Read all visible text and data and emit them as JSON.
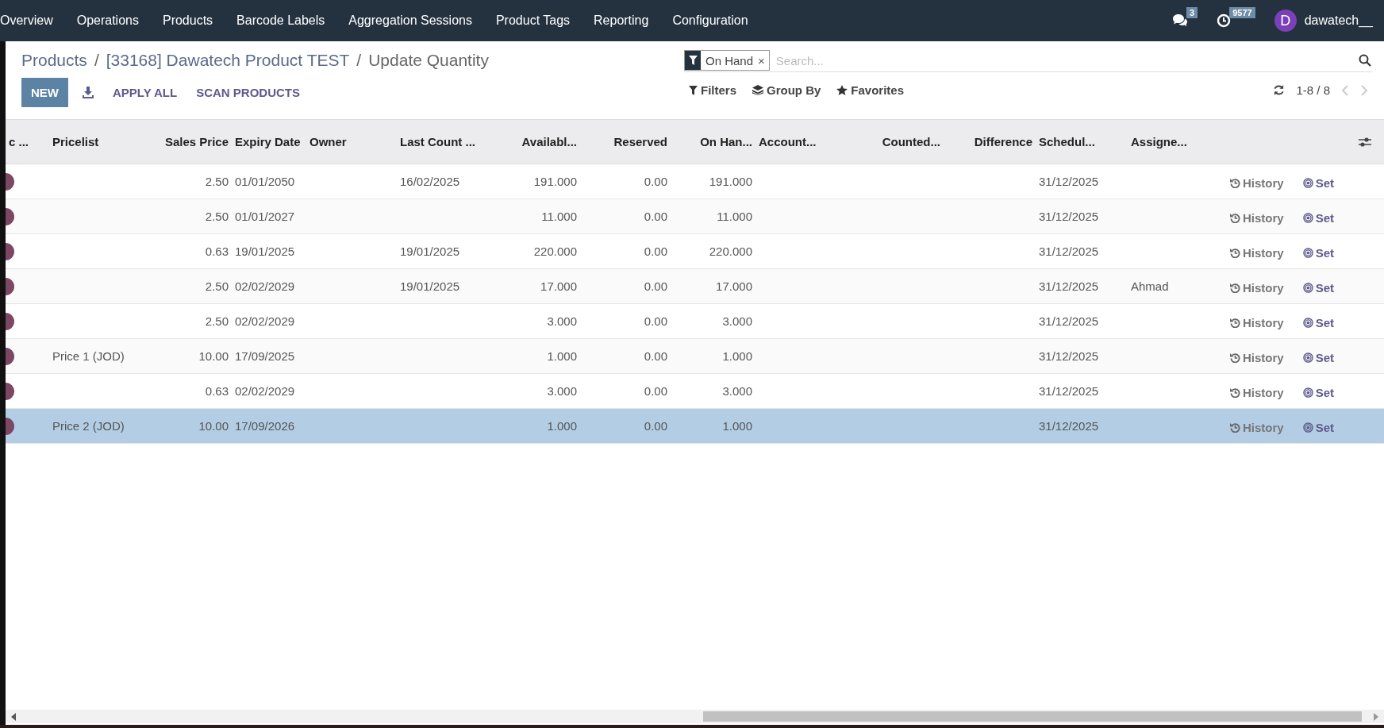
{
  "navbar": {
    "menu": [
      "Overview",
      "Operations",
      "Products",
      "Barcode Labels",
      "Aggregation Sessions",
      "Product Tags",
      "Reporting",
      "Configuration"
    ],
    "messages_badge": "3",
    "activities_badge": "9577",
    "user_initial": "D",
    "user_name": "dawatech__"
  },
  "breadcrumb": [
    {
      "label": "Products"
    },
    {
      "separator": "/",
      "label": "[33168] Dawatech Product TEST"
    },
    {
      "separator": "/",
      "label": "Update Quantity"
    }
  ],
  "buttons": {
    "new": "NEW",
    "apply_all": "APPLY ALL",
    "scan": "SCAN PRODUCTS"
  },
  "search": {
    "facet": "On Hand",
    "facet_remove": "×",
    "placeholder": "Search..."
  },
  "search_options": [
    "Filters",
    "Group By",
    "Favorites"
  ],
  "pager": "1-8 / 8",
  "table": {
    "columns": [
      "c ...",
      "Pricelist",
      "Sales Price",
      "Expiry Date",
      "Owner",
      "Last Count ...",
      "Availabl...",
      "Reserved",
      "On Han...",
      "Account...",
      "Counted...",
      "Difference",
      "Schedul...",
      "Assigne..."
    ],
    "rows": [
      {
        "sales_price": "2.50",
        "expiry": "01/01/2050",
        "last_count": "16/02/2025",
        "available": "191.000",
        "reserved": "0.00",
        "on_hand": "191.000",
        "scheduled": "31/12/2025",
        "history": "History",
        "set": "Set",
        "selected": false
      },
      {
        "sales_price": "2.50",
        "expiry": "01/01/2027",
        "available": "11.000",
        "reserved": "0.00",
        "on_hand": "11.000",
        "scheduled": "31/12/2025",
        "history": "History",
        "set": "Set",
        "selected": false
      },
      {
        "sales_price": "0.63",
        "expiry": "19/01/2025",
        "last_count": "19/01/2025",
        "available": "220.000",
        "reserved": "0.00",
        "on_hand": "220.000",
        "scheduled": "31/12/2025",
        "history": "History",
        "set": "Set",
        "selected": false
      },
      {
        "sales_price": "2.50",
        "expiry": "02/02/2029",
        "last_count": "19/01/2025",
        "available": "17.000",
        "reserved": "0.00",
        "on_hand": "17.000",
        "scheduled": "31/12/2025",
        "assigned": "Ahmad",
        "history": "History",
        "set": "Set",
        "selected": false
      },
      {
        "sales_price": "2.50",
        "expiry": "02/02/2029",
        "available": "3.000",
        "reserved": "0.00",
        "on_hand": "3.000",
        "scheduled": "31/12/2025",
        "history": "History",
        "set": "Set",
        "selected": false
      },
      {
        "pricelist": "Price 1 (JOD)",
        "sales_price": "10.00",
        "expiry": "17/09/2025",
        "available": "1.000",
        "reserved": "0.00",
        "on_hand": "1.000",
        "scheduled": "31/12/2025",
        "history": "History",
        "set": "Set",
        "selected": false
      },
      {
        "sales_price": "0.63",
        "expiry": "02/02/2029",
        "available": "3.000",
        "reserved": "0.00",
        "on_hand": "3.000",
        "scheduled": "31/12/2025",
        "history": "History",
        "set": "Set",
        "selected": false
      },
      {
        "pricelist": "Price 2 (JOD)",
        "sales_price": "10.00",
        "expiry": "17/09/2026",
        "available": "1.000",
        "reserved": "0.00",
        "on_hand": "1.000",
        "scheduled": "31/12/2025",
        "history": "History",
        "set": "Set",
        "selected": true
      }
    ]
  }
}
